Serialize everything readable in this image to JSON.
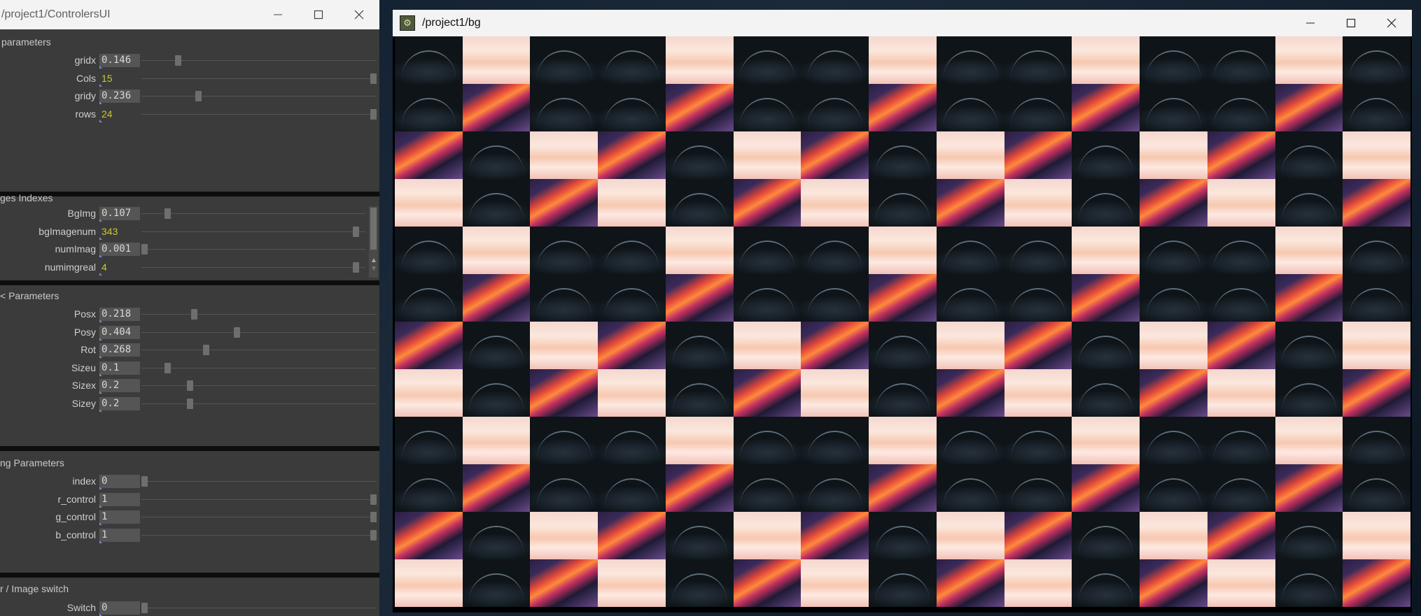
{
  "controllers_window": {
    "title": "/project1/ControlersUI",
    "sections": [
      {
        "title": "parameters",
        "rows": [
          {
            "label": "gridx",
            "value": "0.146",
            "type": "float",
            "level": 0.146
          },
          {
            "label": "Cols",
            "value": "15",
            "type": "int",
            "level": 1.0
          },
          {
            "label": "gridy",
            "value": "0.236",
            "type": "float",
            "level": 0.236
          },
          {
            "label": "rows",
            "value": "24",
            "type": "int",
            "level": 1.0
          }
        ]
      },
      {
        "title": "ges Indexes",
        "rows": [
          {
            "label": "BgImg",
            "value": "0.107",
            "type": "float",
            "level": 0.107
          },
          {
            "label": "bgImagenum",
            "value": "343",
            "type": "int",
            "level": 0.97
          },
          {
            "label": "numImag",
            "value": "0.001",
            "type": "float",
            "level": 0.001
          },
          {
            "label": "numimgreal",
            "value": "4",
            "type": "int",
            "level": 0.97
          }
        ]
      },
      {
        "title": "< Parameters",
        "rows": [
          {
            "label": "Posx",
            "value": "0.218",
            "type": "float",
            "level": 0.218
          },
          {
            "label": "Posy",
            "value": "0.404",
            "type": "float",
            "level": 0.404
          },
          {
            "label": "Rot",
            "value": "0.268",
            "type": "float",
            "level": 0.268
          },
          {
            "label": "Sizeu",
            "value": "0.1",
            "type": "float",
            "level": 0.1
          },
          {
            "label": "Sizex",
            "value": "0.2",
            "type": "float",
            "level": 0.2
          },
          {
            "label": "Sizey",
            "value": "0.2",
            "type": "float",
            "level": 0.2
          }
        ]
      },
      {
        "title": "ng Parameters",
        "rows": [
          {
            "label": "index",
            "value": "0",
            "type": "float",
            "level": 0
          },
          {
            "label": "r_control",
            "value": "1",
            "type": "float",
            "level": 1
          },
          {
            "label": "g_control",
            "value": "1",
            "type": "float",
            "level": 1
          },
          {
            "label": "b_control",
            "value": "1",
            "type": "float",
            "level": 1
          }
        ]
      },
      {
        "title": "r / Image switch",
        "rows": [
          {
            "label": "Switch",
            "value": "0",
            "type": "float",
            "level": 0
          }
        ]
      }
    ]
  },
  "bg_window": {
    "title": "/project1/bg",
    "grid_columns": 15,
    "grid_rows": 12
  },
  "window_controls": {
    "minimize": "minimize-icon",
    "maximize": "maximize-icon",
    "close": "close-icon"
  },
  "colors": {
    "panel_bg": "#3b3b3b",
    "int_value": "#c8c834",
    "field_bg": "#555555"
  }
}
